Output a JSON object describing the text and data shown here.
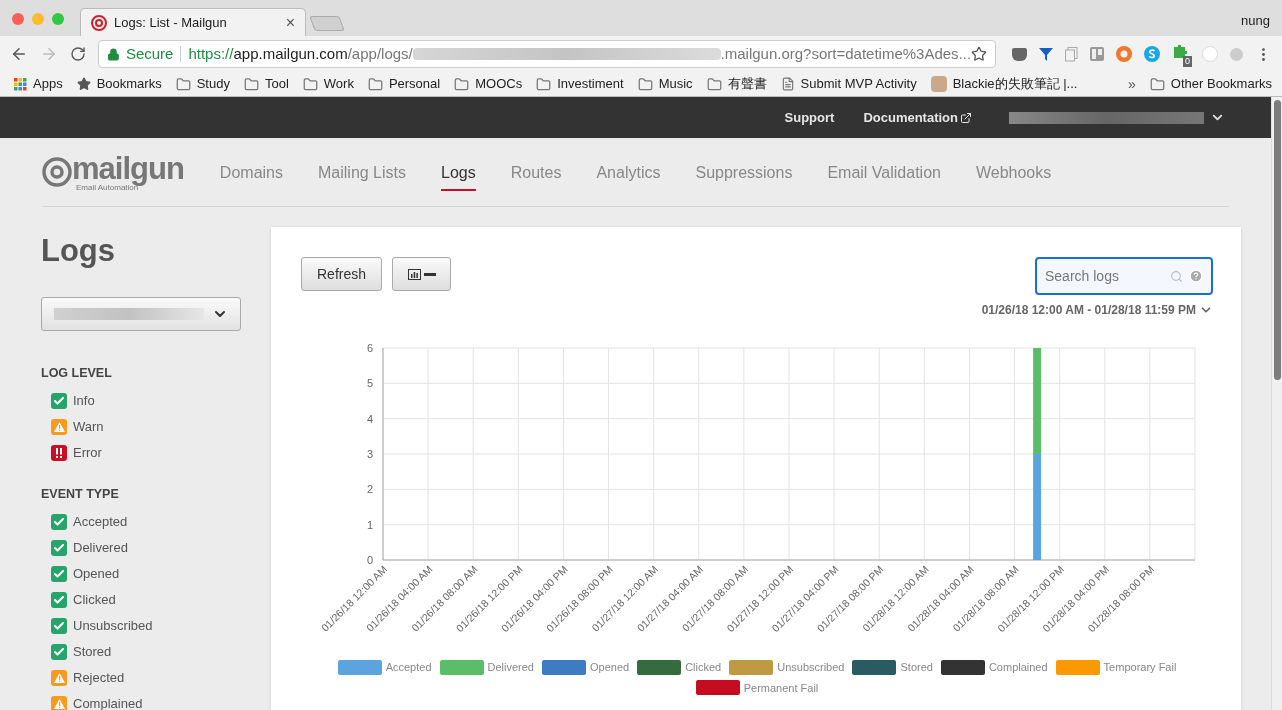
{
  "browser": {
    "tab_title": "Logs: List - Mailgun",
    "tab_close": "×",
    "profile": "nung",
    "url": {
      "secure_label": "Secure",
      "scheme": "https://",
      "host": "app.mailgun.com",
      "path": "/app/logs/",
      "tail": ".mailgun.org?sort=datetime%3Ades..."
    },
    "extension_badge": "0",
    "bookmarks": [
      {
        "kind": "apps",
        "label": "Apps"
      },
      {
        "kind": "star",
        "label": "Bookmarks"
      },
      {
        "kind": "folder",
        "label": "Study"
      },
      {
        "kind": "folder",
        "label": "Tool"
      },
      {
        "kind": "folder",
        "label": "Work"
      },
      {
        "kind": "folder",
        "label": "Personal"
      },
      {
        "kind": "folder",
        "label": "MOOCs"
      },
      {
        "kind": "folder",
        "label": "Investiment"
      },
      {
        "kind": "folder",
        "label": "Music"
      },
      {
        "kind": "folder",
        "label": "有聲書"
      },
      {
        "kind": "page",
        "label": "Submit MVP Activity"
      },
      {
        "kind": "avatar",
        "label": "Blackie的失敗筆記 |..."
      }
    ],
    "overflow": "»",
    "other_bookmarks": "Other Bookmarks"
  },
  "top_bar": {
    "links": [
      "Support",
      "Documentation"
    ]
  },
  "logo": {
    "name": "mailgun",
    "tagline": "Email Automation"
  },
  "nav": [
    {
      "label": "Domains",
      "selected": false
    },
    {
      "label": "Mailing Lists",
      "selected": false
    },
    {
      "label": "Logs",
      "selected": true
    },
    {
      "label": "Routes",
      "selected": false
    },
    {
      "label": "Analytics",
      "selected": false
    },
    {
      "label": "Suppressions",
      "selected": false
    },
    {
      "label": "Email Validation",
      "selected": false
    },
    {
      "label": "Webhooks",
      "selected": false
    }
  ],
  "page_title": "Logs",
  "filters": [
    {
      "heading": "LOG LEVEL",
      "items": [
        {
          "label": "Info",
          "kind": "info",
          "checked": true
        },
        {
          "label": "Warn",
          "kind": "warn",
          "checked": true
        },
        {
          "label": "Error",
          "kind": "error",
          "checked": true
        }
      ]
    },
    {
      "heading": "EVENT TYPE",
      "items": [
        {
          "label": "Accepted",
          "kind": "info",
          "checked": true
        },
        {
          "label": "Delivered",
          "kind": "info",
          "checked": true
        },
        {
          "label": "Opened",
          "kind": "info",
          "checked": true
        },
        {
          "label": "Clicked",
          "kind": "info",
          "checked": true
        },
        {
          "label": "Unsubscribed",
          "kind": "info",
          "checked": true
        },
        {
          "label": "Stored",
          "kind": "info",
          "checked": true
        },
        {
          "label": "Rejected",
          "kind": "warn",
          "checked": true
        },
        {
          "label": "Complained",
          "kind": "warn",
          "checked": true
        }
      ]
    }
  ],
  "toolbar": {
    "refresh": "Refresh",
    "search": {
      "placeholder": "Search logs"
    },
    "date_range": "01/26/18 12:00 AM - 01/28/18 11:59 PM"
  },
  "chart_data": {
    "type": "bar",
    "stacked": true,
    "grid": true,
    "legend": "bottom",
    "categories": [
      "01/26/18 12:00 AM",
      "01/26/18 04:00 AM",
      "01/26/18 08:00 AM",
      "01/26/18 12:00 PM",
      "01/26/18 04:00 PM",
      "01/26/18 08:00 PM",
      "01/27/18 12:00 AM",
      "01/27/18 04:00 AM",
      "01/27/18 08:00 AM",
      "01/27/18 12:00 PM",
      "01/27/18 04:00 PM",
      "01/27/18 08:00 PM",
      "01/28/18 12:00 AM",
      "01/28/18 04:00 AM",
      "01/28/18 08:00 AM",
      "01/28/18 12:00 PM",
      "01/28/18 04:00 PM",
      "01/28/18 08:00 PM"
    ],
    "ylim": [
      0,
      6
    ],
    "yticks": [
      0,
      1,
      2,
      3,
      4,
      5,
      6
    ],
    "series": [
      {
        "name": "Accepted",
        "color": "#5ba4dd",
        "values": [
          0,
          0,
          0,
          0,
          0,
          0,
          0,
          0,
          0,
          0,
          0,
          0,
          0,
          0,
          3,
          0,
          0,
          0
        ]
      },
      {
        "name": "Delivered",
        "color": "#5cbd68",
        "values": [
          0,
          0,
          0,
          0,
          0,
          0,
          0,
          0,
          0,
          0,
          0,
          0,
          0,
          0,
          3,
          0,
          0,
          0
        ]
      },
      {
        "name": "Opened",
        "color": "#3d7bc4",
        "values": [
          0,
          0,
          0,
          0,
          0,
          0,
          0,
          0,
          0,
          0,
          0,
          0,
          0,
          0,
          0,
          0,
          0,
          0
        ]
      },
      {
        "name": "Clicked",
        "color": "#356b3e",
        "values": [
          0,
          0,
          0,
          0,
          0,
          0,
          0,
          0,
          0,
          0,
          0,
          0,
          0,
          0,
          0,
          0,
          0,
          0
        ]
      },
      {
        "name": "Unsubscribed",
        "color": "#bf9a42",
        "values": [
          0,
          0,
          0,
          0,
          0,
          0,
          0,
          0,
          0,
          0,
          0,
          0,
          0,
          0,
          0,
          0,
          0,
          0
        ]
      },
      {
        "name": "Stored",
        "color": "#285c60",
        "values": [
          0,
          0,
          0,
          0,
          0,
          0,
          0,
          0,
          0,
          0,
          0,
          0,
          0,
          0,
          0,
          0,
          0,
          0
        ]
      },
      {
        "name": "Complained",
        "color": "#333333",
        "values": [
          0,
          0,
          0,
          0,
          0,
          0,
          0,
          0,
          0,
          0,
          0,
          0,
          0,
          0,
          0,
          0,
          0,
          0
        ]
      },
      {
        "name": "Temporary Fail",
        "color": "#fb9903",
        "values": [
          0,
          0,
          0,
          0,
          0,
          0,
          0,
          0,
          0,
          0,
          0,
          0,
          0,
          0,
          0,
          0,
          0,
          0
        ]
      },
      {
        "name": "Permanent Fail",
        "color": "#c60c20",
        "values": [
          0,
          0,
          0,
          0,
          0,
          0,
          0,
          0,
          0,
          0,
          0,
          0,
          0,
          0,
          0,
          0,
          0,
          0
        ]
      }
    ]
  }
}
